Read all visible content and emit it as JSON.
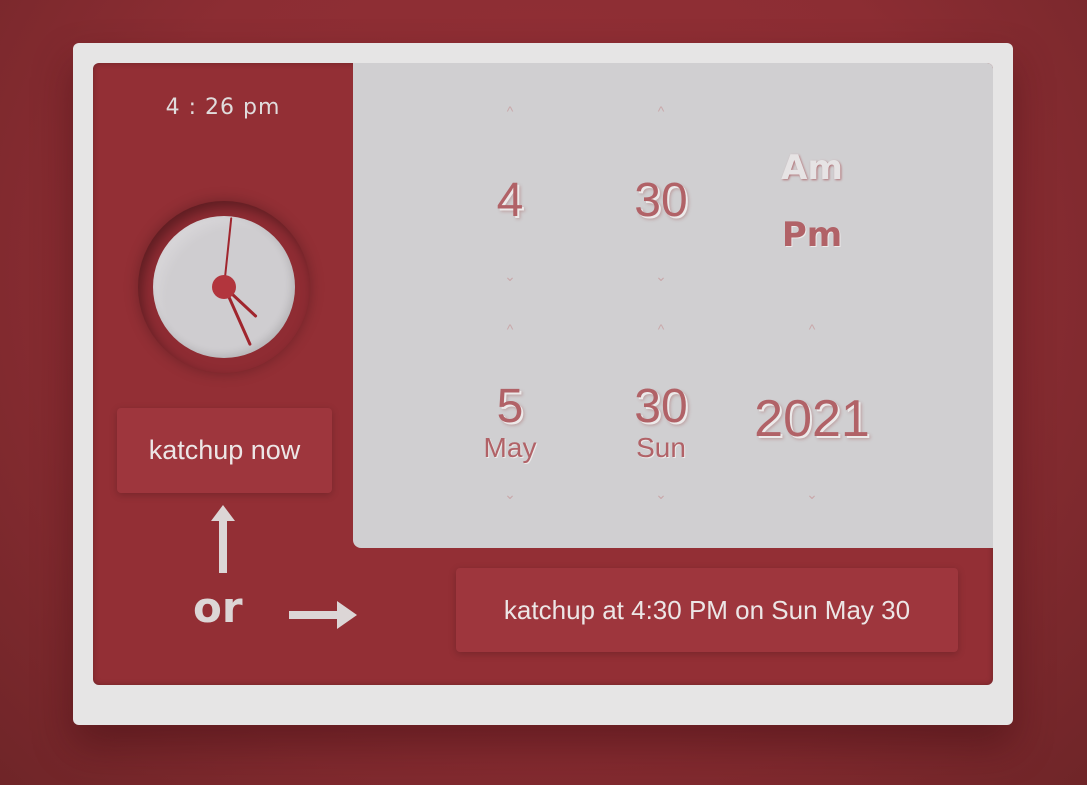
{
  "clock": {
    "digital": "4 : 26 pm",
    "hour": 4,
    "minute": 26,
    "second": 1
  },
  "time_picker": {
    "hour": "4",
    "minute": "30",
    "am_label": "Am",
    "pm_label": "Pm",
    "selected_period": "Pm"
  },
  "date_picker": {
    "month_number": "5",
    "month_name": "May",
    "day": "30",
    "weekday": "Sun",
    "year": "2021"
  },
  "chevrons": {
    "up": "^",
    "down": "⌄"
  },
  "buttons": {
    "now": "katchup now",
    "scheduled": "katchup at 4:30 PM on Sun May 30"
  },
  "or_label": "or",
  "colors": {
    "accent": "#932f35",
    "picker_bg": "#d0cfd1",
    "text_accent": "#b16267"
  }
}
